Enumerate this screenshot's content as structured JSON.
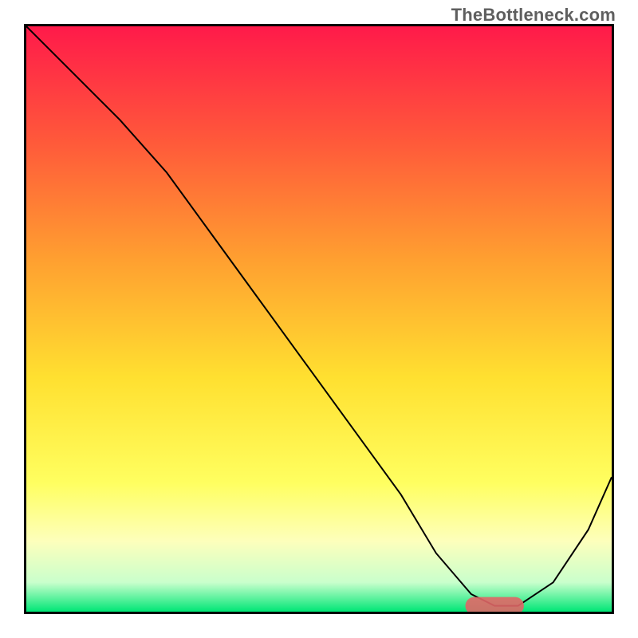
{
  "watermark": "TheBottleneck.com",
  "chart_data": {
    "type": "line",
    "title": "",
    "xlabel": "",
    "ylabel": "",
    "xlim": [
      0,
      100
    ],
    "ylim": [
      0,
      100
    ],
    "grid": false,
    "legend": false,
    "background_gradient": {
      "stops": [
        {
          "offset": 0.0,
          "color": "#ff1a4a"
        },
        {
          "offset": 0.2,
          "color": "#ff5a3a"
        },
        {
          "offset": 0.4,
          "color": "#ffa030"
        },
        {
          "offset": 0.6,
          "color": "#ffe030"
        },
        {
          "offset": 0.78,
          "color": "#ffff60"
        },
        {
          "offset": 0.88,
          "color": "#fdffbc"
        },
        {
          "offset": 0.95,
          "color": "#c9ffcc"
        },
        {
          "offset": 1.0,
          "color": "#00e676"
        }
      ]
    },
    "series": [
      {
        "name": "curve",
        "color": "#000000",
        "stroke_width": 2,
        "x": [
          0,
          8,
          16,
          24,
          32,
          40,
          48,
          56,
          64,
          70,
          76,
          80,
          84,
          90,
          96,
          100
        ],
        "y": [
          100,
          92,
          84,
          75,
          64,
          53,
          42,
          31,
          20,
          10,
          3,
          1,
          1,
          5,
          14,
          23
        ]
      }
    ],
    "markers": [
      {
        "name": "sweet-spot",
        "shape": "pill",
        "color": "#e06666",
        "opacity": 0.9,
        "x_center": 80,
        "y_center": 1,
        "width": 10,
        "height": 3
      }
    ]
  }
}
